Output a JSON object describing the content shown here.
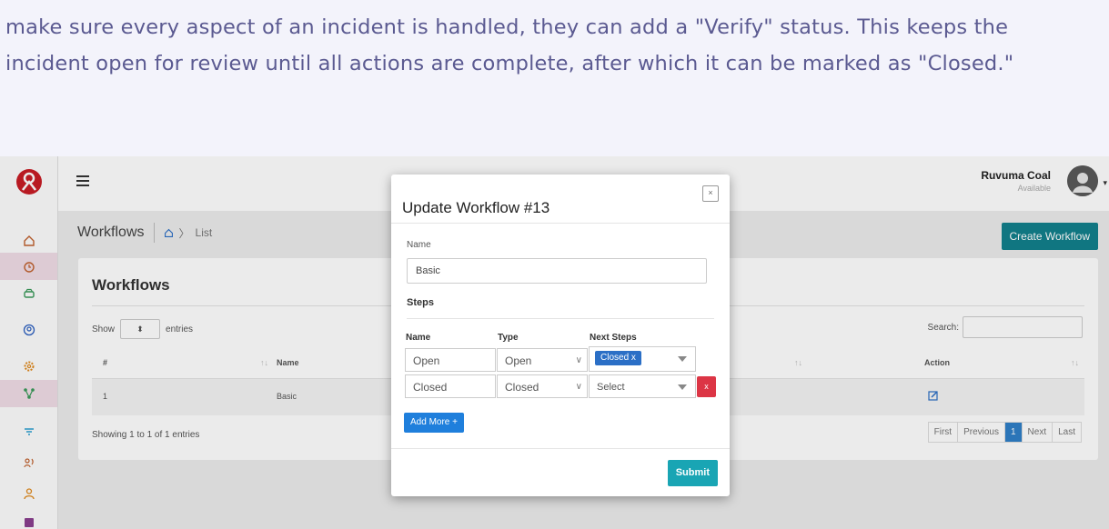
{
  "intro": {
    "text": "make sure every aspect of an incident is handled, they can add a \"Verify\" status. This keeps the incident open for review until all actions are complete, after which it can be marked as \"Closed.\""
  },
  "user": {
    "name": "Ruvuma Coal",
    "status": "Available"
  },
  "page": {
    "title": "Workflows",
    "breadcrumb": "List",
    "create_label": "Create Workflow"
  },
  "table_card": {
    "title": "Workflows",
    "show_label": "Show",
    "entries_label": "entries",
    "search_label": "Search:",
    "headers": {
      "num": "#",
      "name": "Name",
      "action": "Action"
    },
    "rows": [
      {
        "num": "1",
        "name": "Basic"
      }
    ],
    "showing": "Showing 1 to 1 of 1 entries",
    "pager": {
      "first": "First",
      "previous": "Previous",
      "current": "1",
      "next": "Next",
      "last": "Last"
    }
  },
  "modal": {
    "title": "Update Workflow #13",
    "close": "×",
    "name_label": "Name",
    "name_value": "Basic",
    "steps_label": "Steps",
    "col_name": "Name",
    "col_type": "Type",
    "col_next": "Next Steps",
    "steps": [
      {
        "name": "Open",
        "type": "Open",
        "next_chip": "Closed x"
      },
      {
        "name": "Closed",
        "type": "Closed",
        "next_placeholder": "Select"
      }
    ],
    "remove_label": "x",
    "add_label": "Add More +",
    "submit_label": "Submit"
  },
  "colors": {
    "accent_teal": "#12808c",
    "danger": "#dc3545",
    "primary": "#1f7fdc",
    "sidebar_icon": "#c0612e",
    "sidebar_icon_alt": "#3a9a5a"
  },
  "icons": {
    "sidebar": [
      "home-icon",
      "alarm-icon",
      "car-icon",
      "user-circle-icon",
      "gear-icon",
      "workflow-icon",
      "filter-icon",
      "broadcast-icon",
      "person-icon",
      "save-icon"
    ]
  }
}
